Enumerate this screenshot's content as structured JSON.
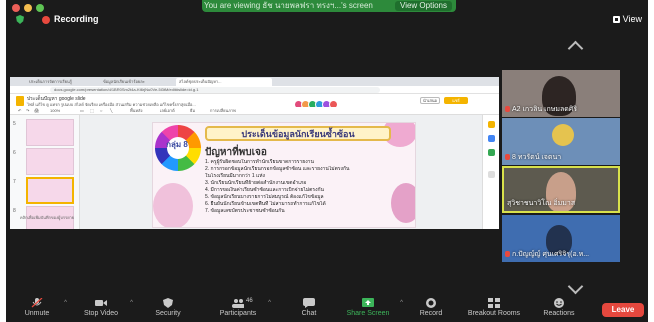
{
  "banner": {
    "message": "You are viewing ธัช นายพลฟรา ทรงฯ...'s screen",
    "view_options": "View Options"
  },
  "recording": {
    "label": "Recording"
  },
  "view": {
    "label": "View"
  },
  "browser": {
    "tabs": [
      "ประเด็นการจัดการเรียนรู้",
      "ข้อมูลนักเรียนเข้าร้อยละ",
      "สไลด์ชุดประเด็นปัญหา..."
    ],
    "address": "docs.google.com/presentation/d/1BR0Sm2t4a-Kt6rjNu0Ve-5l3tM/edit#slide=id.g.1"
  },
  "doc": {
    "title": "ประเด็นปัญหา google slide",
    "menu": "ไฟล์  แก้ไข  ดู  แทรก  รูปแบบ  สไลด์  จัดเรียง  เครื่องมือ  ส่วนเสริม  ความช่วยเหลือ  แก้ไขครั้งล่าสุดเมื่อ...",
    "present": "นำเสนอ",
    "share": "แชร์",
    "toolbar": [
      "↶",
      "↷",
      "🖨",
      "100%",
      "▭",
      "⬚",
      "○",
      "╲",
      "พื้นหลัง",
      "เลย์เอาต์",
      "ธีม",
      "การเปลี่ยนภาพ"
    ]
  },
  "slide": {
    "group_label": "กลุ่ม 8",
    "title": "ประเด็นข้อมูลนักเรียนซ้ำซ้อน",
    "subtitle": "ปัญหาที่พบเจอ",
    "lines": [
      "1. ครูผู้รับผิดชอบในการทำนักเรียนขาดการรายงาน",
      "2. การกรอกข้อมูลนักเรียนกรอกข้อมูลซ้ำซ้อน และรายงานไม่ตรงกัน",
      "   ในโรงเรียนมีมากกว่า 1 แห่ง",
      "3. นักเรียนนักเรียนที่ย้ายต่อสำนักงานเขตอำเภอ",
      "4. มีการขอเงินค่าเรียนซ้ำซ้อนและการเบิกจ่ายไม่ตรงกัน",
      "5. ข้อมูลนักเรียนบางรายการไม่สมบูรณ์ ต้องแก้ไขข้อมูล",
      "6. ยืนยันนักเรียนข้ามเขตพื้นที่ ไม่สามารถทำการแก้ไขได้",
      "7. ข้อมูลเลขบัตรประชาชนซ้ำซ้อนกัน"
    ],
    "notes": "คลิกเพื่อเพิ่มบันทึกของผู้บรรยาย"
  },
  "thumbnails": [
    "5",
    "6",
    "7",
    "8"
  ],
  "participants": [
    {
      "name": "A2 เกวลิน เกษมลดศิริ",
      "muted": true,
      "bg": "#8a7f7a"
    },
    {
      "name": "8 ทวรัตน์ เจตนา",
      "muted": true,
      "bg": "#6d8fb8"
    },
    {
      "name": "สุวิชาชนาวิโณ อิ่มมาส",
      "muted": false,
      "bg": "#5d5a4f"
    },
    {
      "name": "ก.ปัญญ์ญ์ ศุนเศริจิรุ(อ.ห...",
      "muted": true,
      "bg": "#3f6db0"
    }
  ],
  "controls": [
    {
      "label": "Unmute",
      "icon": "mic-off-icon",
      "caret": true
    },
    {
      "label": "Stop Video",
      "icon": "video-icon",
      "caret": true
    },
    {
      "label": "Security",
      "icon": "shield-icon"
    },
    {
      "label": "Participants",
      "icon": "participants-icon",
      "count": "46",
      "caret": true
    },
    {
      "label": "Chat",
      "icon": "chat-icon"
    },
    {
      "label": "Share Screen",
      "icon": "share-screen-icon",
      "caret": true,
      "accent": "#3cb55a"
    },
    {
      "label": "Record",
      "icon": "record-icon"
    },
    {
      "label": "Breakout Rooms",
      "icon": "breakout-icon"
    },
    {
      "label": "Reactions",
      "icon": "reactions-icon"
    }
  ],
  "leave": "Leave",
  "colors": {
    "zoom_bg": "#1b1b1b",
    "share_green": "#2d8a3b",
    "leave_red": "#e5483e",
    "active_speaker": "#d8e14b"
  }
}
